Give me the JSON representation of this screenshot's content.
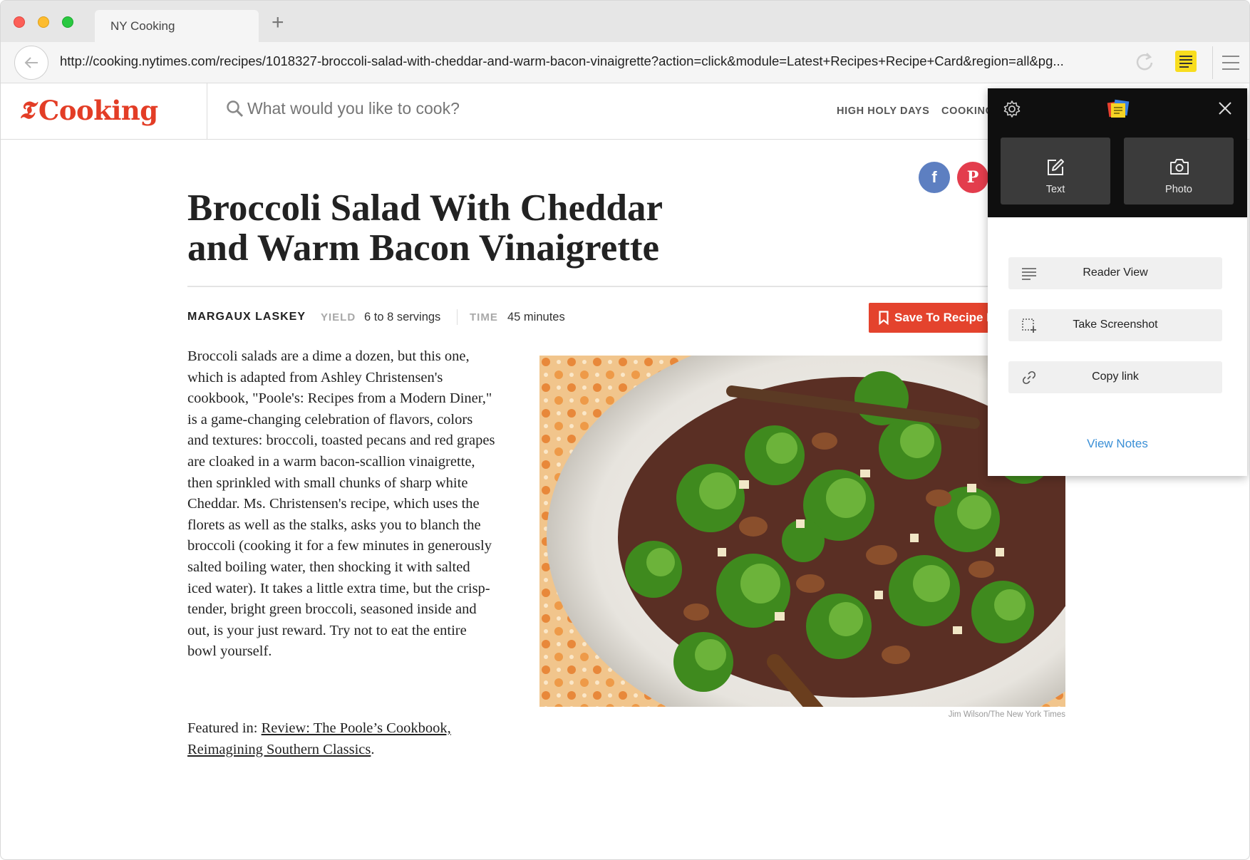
{
  "browser": {
    "tab_title": "NY Cooking",
    "url": "http://cooking.nytimes.com/recipes/1018327-broccoli-salad-with-cheddar-and-warm-bacon-vinaigrette?action=click&module=Latest+Recipes+Recipe+Card&region=all&pg..."
  },
  "site": {
    "logo_text": "Cooking",
    "search_placeholder": "What would you like to cook?",
    "nav": [
      "HIGH HOLY DAYS",
      "COOKING"
    ],
    "brand_color": "#e33d26"
  },
  "recipe": {
    "title": "Broccoli Salad With Cheddar and Warm Bacon Vinaigrette",
    "author": "MARGAUX LASKEY",
    "yield_label": "YIELD",
    "yield_value": "6 to 8 servings",
    "time_label": "TIME",
    "time_value": "45 minutes",
    "save_button": "Save To Recipe B",
    "description": "Broccoli salads are a dime a dozen, but this one, which is adapted from Ashley Christensen's cookbook, \"Poole's: Recipes from a Modern Diner,\" is a game-changing celebration of flavors, colors and textures: broccoli, toasted pecans and red grapes are cloaked in a warm bacon-scallion vinaigrette, then sprinkled with small chunks of sharp white Cheddar. Ms. Christensen's recipe, which uses the florets as well as the stalks, asks you to blanch the broccoli (cooking it for a few minutes in generously salted boiling water, then shocking it with salted iced water). It takes a little extra time, but the crisp-tender, bright green broccoli, seasoned inside and out, is your just reward. Try not to eat the entire bowl yourself.",
    "featured_prefix": "Featured in: ",
    "featured_link": "Review: The Poole’s Cookbook, Reimagining Southern Classics",
    "featured_suffix": ".",
    "photo_credit": "Jim Wilson/The New York Times"
  },
  "social": {
    "facebook_glyph": "f",
    "pinterest_glyph": "P",
    "facebook_color": "#5d7fc1",
    "pinterest_color": "#e33d4d"
  },
  "extension_popup": {
    "capture_buttons": [
      {
        "label": "Text",
        "icon": "edit-icon"
      },
      {
        "label": "Photo",
        "icon": "camera-icon"
      }
    ],
    "actions": [
      {
        "label": "Reader View",
        "icon": "reader-lines-icon"
      },
      {
        "label": "Take Screenshot",
        "icon": "screenshot-crop-icon"
      },
      {
        "label": "Copy link",
        "icon": "link-icon"
      }
    ],
    "view_notes": "View Notes",
    "link_color": "#3a8fd6"
  }
}
